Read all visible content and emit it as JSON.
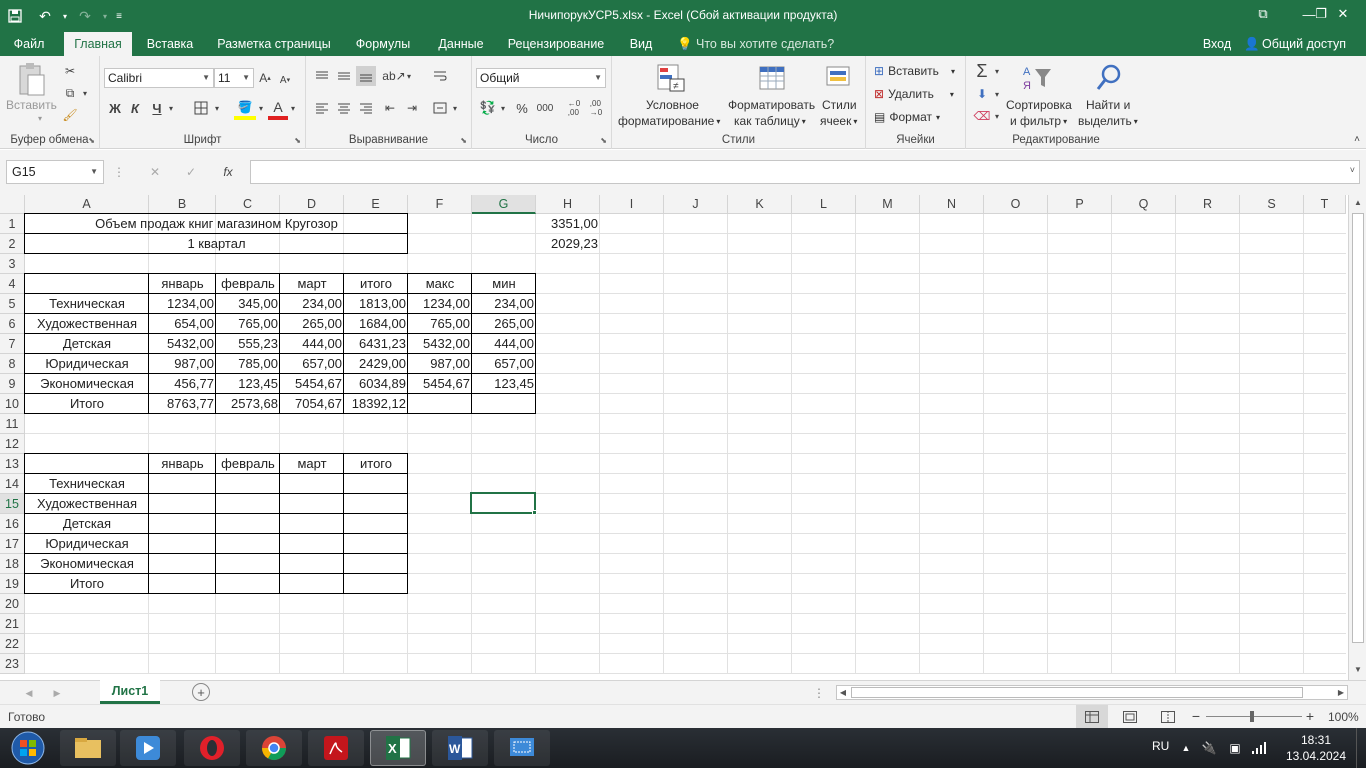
{
  "window": {
    "title": "НичипорукУСР5.xlsx - Excel (Сбой активации продукта)",
    "restore_glyph": "⧉",
    "minimize_glyph": "—",
    "maximize_glyph": "❐",
    "close_glyph": "✕"
  },
  "tabs": {
    "file": "Файл",
    "home": "Главная",
    "insert": "Вставка",
    "layout": "Разметка страницы",
    "formulas": "Формулы",
    "data": "Данные",
    "review": "Рецензирование",
    "view": "Вид",
    "tell_me": "Что вы хотите сделать?",
    "signin": "Вход",
    "share": "Общий доступ"
  },
  "ribbon": {
    "clipboard": {
      "label": "Буфер обмена",
      "paste": "Вставить"
    },
    "font": {
      "label": "Шрифт",
      "name": "Calibri",
      "size": "11",
      "bold": "Ж",
      "italic": "К",
      "underline": "Ч"
    },
    "alignment": {
      "label": "Выравнивание"
    },
    "number": {
      "label": "Число",
      "format": "Общий",
      "percent": "%",
      "thousands": "000"
    },
    "styles": {
      "label": "Стили",
      "conditional_1": "Условное",
      "conditional_2": "форматирование",
      "format_table_1": "Форматировать",
      "format_table_2": "как таблицу",
      "cell_styles_1": "Стили",
      "cell_styles_2": "ячеек"
    },
    "cells": {
      "label": "Ячейки",
      "insert": "Вставить",
      "delete": "Удалить",
      "format": "Формат"
    },
    "editing": {
      "label": "Редактирование",
      "sort_1": "Сортировка",
      "sort_2": "и фильтр",
      "find_1": "Найти и",
      "find_2": "выделить"
    }
  },
  "formula_bar": {
    "name_box": "G15",
    "cancel": "✕",
    "enter": "✓",
    "fx": "fx",
    "value": ""
  },
  "columns": [
    "A",
    "B",
    "C",
    "D",
    "E",
    "F",
    "G",
    "H",
    "I",
    "J",
    "K",
    "L",
    "M",
    "N",
    "O",
    "P",
    "Q",
    "R",
    "S",
    "T"
  ],
  "rows": [
    "1",
    "2",
    "3",
    "4",
    "5",
    "6",
    "7",
    "8",
    "9",
    "10",
    "11",
    "12",
    "13",
    "14",
    "15",
    "16",
    "17",
    "18",
    "19",
    "20",
    "21",
    "22",
    "23"
  ],
  "cells": {
    "A1": "Объем продаж книг магазином Кругозор",
    "A2": "1 квартал",
    "H1": "3351,00",
    "H2": "2029,23",
    "B4": "январь",
    "C4": "февраль",
    "D4": "март",
    "E4": "итого",
    "F4": "макс",
    "G4": "мин",
    "A5": "Техническая",
    "B5": "1234,00",
    "C5": "345,00",
    "D5": "234,00",
    "E5": "1813,00",
    "F5": "1234,00",
    "G5": "234,00",
    "A6": "Художественная",
    "B6": "654,00",
    "C6": "765,00",
    "D6": "265,00",
    "E6": "1684,00",
    "F6": "765,00",
    "G6": "265,00",
    "A7": "Детская",
    "B7": "5432,00",
    "C7": "555,23",
    "D7": "444,00",
    "E7": "6431,23",
    "F7": "5432,00",
    "G7": "444,00",
    "A8": "Юридическая",
    "B8": "987,00",
    "C8": "785,00",
    "D8": "657,00",
    "E8": "2429,00",
    "F8": "987,00",
    "G8": "657,00",
    "A9": "Экономическая",
    "B9": "456,77",
    "C9": "123,45",
    "D9": "5454,67",
    "E9": "6034,89",
    "F9": "5454,67",
    "G9": "123,45",
    "A10": "Итого",
    "B10": "8763,77",
    "C10": "2573,68",
    "D10": "7054,67",
    "E10": "18392,12",
    "B13": "январь",
    "C13": "февраль",
    "D13": "март",
    "E13": "итого",
    "A14": "Техническая",
    "A15": "Художественная",
    "A16": "Детская",
    "A17": "Юридическая",
    "A18": "Экономическая",
    "A19": "Итого"
  },
  "selected_cell": "G15",
  "sheets": [
    {
      "name": "Лист1",
      "active": true
    }
  ],
  "status": {
    "ready": "Готово",
    "zoom": "100%"
  },
  "taskbar": {
    "lang": "RU",
    "time": "18:31",
    "date": "13.04.2024"
  }
}
